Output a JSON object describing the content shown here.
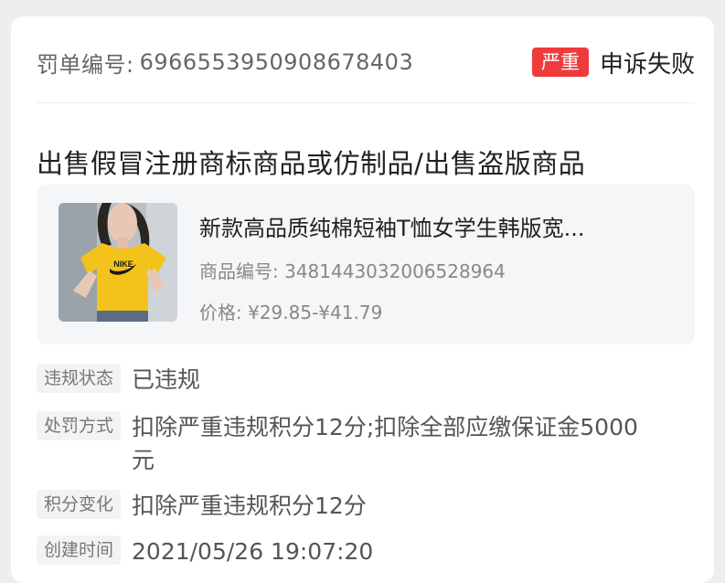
{
  "header": {
    "order_label": "罚单编号:",
    "order_number": "6966553950908678403",
    "severity_badge": "严重",
    "status": "申诉失败"
  },
  "violation_title": "出售假冒注册商标商品或仿制品/出售盗版商品",
  "product": {
    "name": "新款高品质纯棉短袖T恤女学生韩版宽...",
    "id_label": "商品编号:",
    "id": "3481443032006528964",
    "price_label": "价格:",
    "price": "¥29.85-¥41.79",
    "image_text": "NIKE"
  },
  "details": [
    {
      "label": "违规状态",
      "value": "已违规"
    },
    {
      "label": "处罚方式",
      "value": "扣除严重违规积分12分;扣除全部应缴保证金5000元"
    },
    {
      "label": "积分变化",
      "value": "扣除严重违规积分12分"
    },
    {
      "label": "创建时间",
      "value": "2021/05/26 19:07:20"
    }
  ],
  "colors": {
    "badge_red": "#ef3b3b",
    "shirt_yellow": "#f3c31c"
  }
}
